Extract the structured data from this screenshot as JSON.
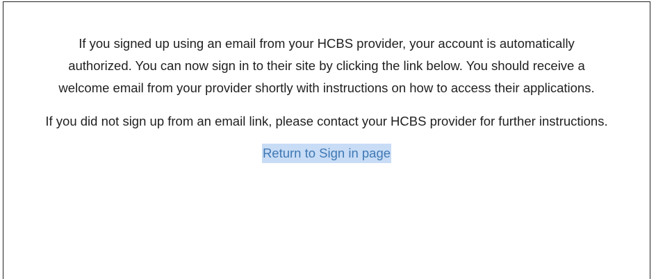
{
  "message": {
    "paragraph_1": "If you signed up using an email from your HCBS provider, your account is automatically authorized. You can now sign in to their site by clicking the link below. You should receive a welcome email from your provider shortly with instructions on how to access their applications.",
    "paragraph_2": "If you did not sign up from an email link, please contact your HCBS provider for further instructions."
  },
  "link": {
    "label": "Return to Sign in page",
    "color": "#3f78b3",
    "highlight": "#c8dcf6"
  }
}
